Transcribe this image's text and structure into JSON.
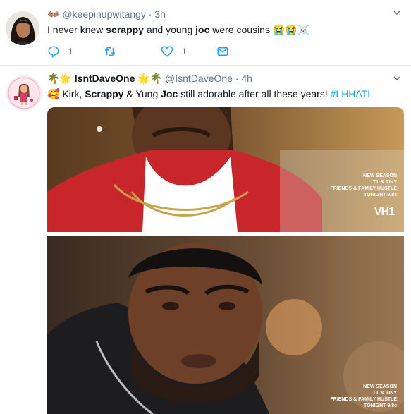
{
  "tweets": [
    {
      "name_emoji": "👐🏽",
      "handle": "@keepinupwitangy",
      "separator": "·",
      "time": "3h",
      "text": {
        "part1": "I never knew ",
        "bold1": "scrappy",
        "part2": " and young ",
        "bold2": "joc",
        "part3": " were cousins ",
        "emoji": "😭😭☠️"
      },
      "actions": {
        "reply_count": "1",
        "retweet_count": "",
        "like_count": "1"
      }
    },
    {
      "name_prefix_emoji": "🌴🌟",
      "name": "IsntDaveOne",
      "name_suffix_emoji": "🌟🌴",
      "handle": "@IsntDaveOne",
      "separator": "·",
      "time": "4h",
      "text": {
        "emoji": "🥰",
        "part1": " Kirk, ",
        "bold1": "Scrappy",
        "part2": " & Yung ",
        "bold2": "Joc",
        "part3": " still adorable after all these years! ",
        "hashtag": "#LHHATL"
      },
      "media": {
        "image1_overlay": [
          "NEW SEASON",
          "T.I. & TINY",
          "FRIENDS & FAMILY HUSTLE",
          "TONIGHT 9/8c"
        ],
        "network_logo": "VH1",
        "image2_overlay": [
          "NEW SEASON",
          "T.I. & TINY",
          "FRIENDS & FAMILY HUSTLE",
          "TONIGHT 9/8c"
        ]
      }
    }
  ],
  "colors": {
    "link": "#1da1f2",
    "muted": "#657786",
    "text": "#14171a",
    "divider": "#e6ecf0"
  }
}
